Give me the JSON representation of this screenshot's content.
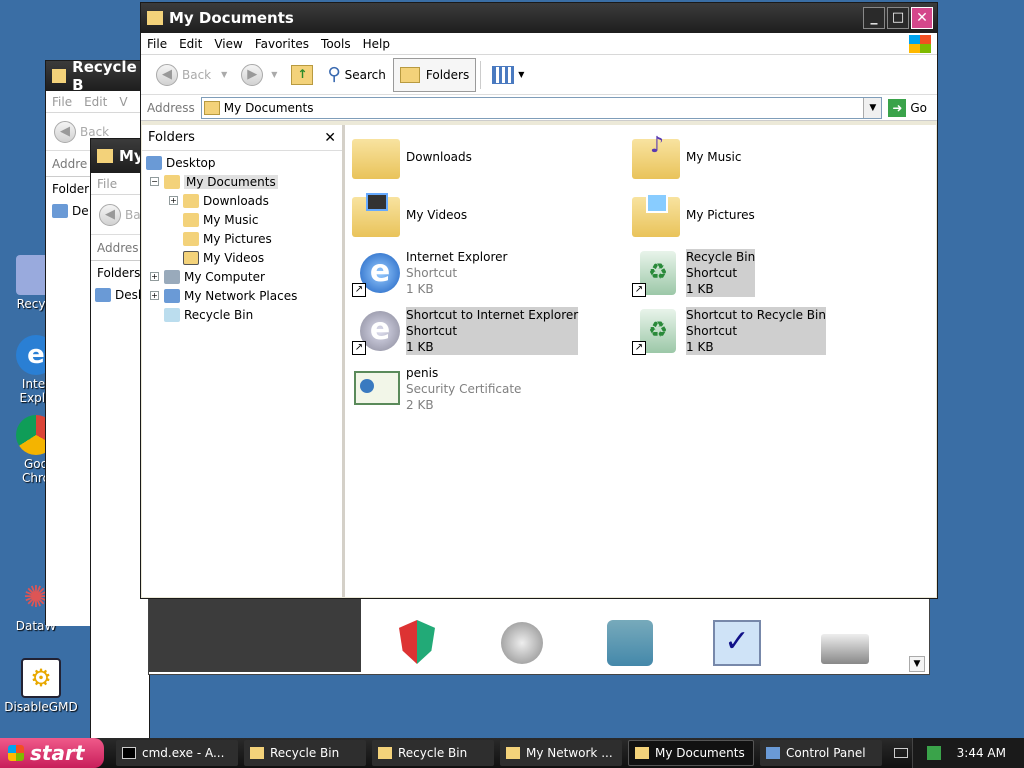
{
  "desktop": {
    "icons": [
      {
        "label": "Recycl",
        "icon": "recycle-bin-icon"
      },
      {
        "label": "Inter Explo",
        "icon": "internet-explorer-icon"
      },
      {
        "label": "Goo Chro",
        "icon": "chrome-icon"
      },
      {
        "label": "DataW",
        "icon": "datawatch-icon"
      },
      {
        "label": "DisableGMD",
        "icon": "gear-icon"
      }
    ]
  },
  "bg_windows": {
    "recycle": {
      "title": "Recycle B",
      "menu": [
        "File",
        "Edit",
        "V"
      ],
      "back": "Back",
      "address": "Addre",
      "folders": "Folder",
      "tree_first": "De"
    },
    "mynet": {
      "title": "My",
      "menu": [
        "File"
      ],
      "back": "Ba",
      "address": "Addres",
      "folders": "Folders",
      "tree_first": "Desk"
    }
  },
  "main_window": {
    "title": "My Documents",
    "menu": [
      "File",
      "Edit",
      "View",
      "Favorites",
      "Tools",
      "Help"
    ],
    "toolbar": {
      "back": "Back",
      "search": "Search",
      "folders": "Folders"
    },
    "address": {
      "label": "Address",
      "value": "My Documents",
      "go": "Go"
    },
    "folders_pane": {
      "title": "Folders",
      "tree": [
        {
          "label": "Desktop",
          "indent": 0,
          "expander": "",
          "icon": "desktop-icon"
        },
        {
          "label": "My Documents",
          "indent": 1,
          "expander": "−",
          "icon": "folder-open-icon",
          "selected": true
        },
        {
          "label": "Downloads",
          "indent": 2,
          "expander": "+",
          "icon": "folder-icon"
        },
        {
          "label": "My Music",
          "indent": 2,
          "expander": "",
          "icon": "music-folder-icon"
        },
        {
          "label": "My Pictures",
          "indent": 2,
          "expander": "",
          "icon": "pictures-folder-icon"
        },
        {
          "label": "My Videos",
          "indent": 2,
          "expander": "",
          "icon": "videos-folder-icon"
        },
        {
          "label": "My Computer",
          "indent": 1,
          "expander": "+",
          "icon": "computer-icon"
        },
        {
          "label": "My Network Places",
          "indent": 1,
          "expander": "+",
          "icon": "network-icon"
        },
        {
          "label": "Recycle Bin",
          "indent": 1,
          "expander": "",
          "icon": "recycle-bin-icon"
        }
      ]
    },
    "files": [
      {
        "name": "Downloads",
        "type": "",
        "size": "",
        "icon": "folder-icon",
        "selected": false,
        "shortcut": false
      },
      {
        "name": "My Music",
        "type": "",
        "size": "",
        "icon": "music-folder-icon",
        "selected": false,
        "shortcut": false
      },
      {
        "name": "My Videos",
        "type": "",
        "size": "",
        "icon": "videos-folder-icon",
        "selected": false,
        "shortcut": false
      },
      {
        "name": "My Pictures",
        "type": "",
        "size": "",
        "icon": "pictures-folder-icon",
        "selected": false,
        "shortcut": false
      },
      {
        "name": "Internet Explorer",
        "type": "Shortcut",
        "size": "1 KB",
        "icon": "internet-explorer-icon",
        "selected": false,
        "shortcut": true
      },
      {
        "name": "Recycle Bin",
        "type": "Shortcut",
        "size": "1 KB",
        "icon": "recycle-bin-icon",
        "selected": true,
        "shortcut": true
      },
      {
        "name": "Shortcut to Internet Explorer",
        "type": "Shortcut",
        "size": "1 KB",
        "icon": "internet-explorer-icon",
        "selected": true,
        "shortcut": true
      },
      {
        "name": "Shortcut to Recycle Bin",
        "type": "Shortcut",
        "size": "1 KB",
        "icon": "recycle-bin-icon",
        "selected": true,
        "shortcut": true
      },
      {
        "name": "penis",
        "type": "Security Certificate",
        "size": "2 KB",
        "icon": "certificate-icon",
        "selected": false,
        "shortcut": false
      }
    ]
  },
  "control_panel_icons": [
    "security-center-icon",
    "sounds-icon",
    "user-accounts-icon",
    "system-check-icon",
    "printer-icon"
  ],
  "taskbar": {
    "start": "start",
    "tasks": [
      {
        "label": "cmd.exe - A...",
        "active": false
      },
      {
        "label": "Recycle Bin",
        "active": false
      },
      {
        "label": "Recycle Bin",
        "active": false
      },
      {
        "label": "My Network ...",
        "active": false
      },
      {
        "label": "My Documents",
        "active": true
      },
      {
        "label": "Control Panel",
        "active": false
      }
    ],
    "clock": "3:44 AM"
  }
}
